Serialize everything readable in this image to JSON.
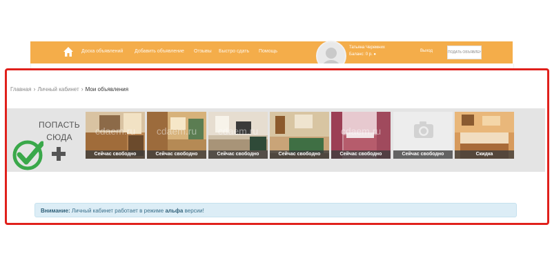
{
  "header": {
    "nav": [
      "Доска объявлений",
      "Добавить объявление",
      "Отзывы",
      "Быстро сдать",
      "Помощь"
    ],
    "user_name": "Татьяна Черемних",
    "user_meta": "Баланс: 0 р. ●",
    "exit": "Выход",
    "add_button": "ПОДАТЬ ОБЪЯВЛЕНИЕ",
    "brand_color": "#f4ad4a"
  },
  "breadcrumb": {
    "items": [
      "Главная",
      "Личный кабинет"
    ],
    "current": "Мои объявления"
  },
  "promo": {
    "line1": "ПОПАСТЬ",
    "line2": "СЮДА"
  },
  "listings": [
    {
      "caption": "Сейчас свободно",
      "watermark": "cdaem.ru",
      "photo": "kitchen"
    },
    {
      "caption": "Сейчас свободно",
      "watermark": "cdaem.ru",
      "photo": "bedroom-bright"
    },
    {
      "caption": "Сейчас свободно",
      "watermark": "cdaem.ru",
      "photo": "living-room"
    },
    {
      "caption": "Сейчас свободно",
      "watermark": "",
      "photo": "green-sofa"
    },
    {
      "caption": "Сейчас свободно",
      "watermark": "cdaem.ru",
      "photo": "pink-bedroom"
    },
    {
      "caption": "Сейчас свободно",
      "watermark": "",
      "photo": "camera-placeholder"
    },
    {
      "caption": "Скидка",
      "watermark": "",
      "photo": "warm-bedroom"
    }
  ],
  "alert": {
    "label": "Внимание:",
    "text_before": "Личный кабинет работает в режиме",
    "emphasis": "альфа",
    "text_after": "версии!"
  },
  "colors": {
    "highlight": "#e0201b",
    "check": "#3aa84a",
    "alert_bg": "#dcedf6"
  }
}
